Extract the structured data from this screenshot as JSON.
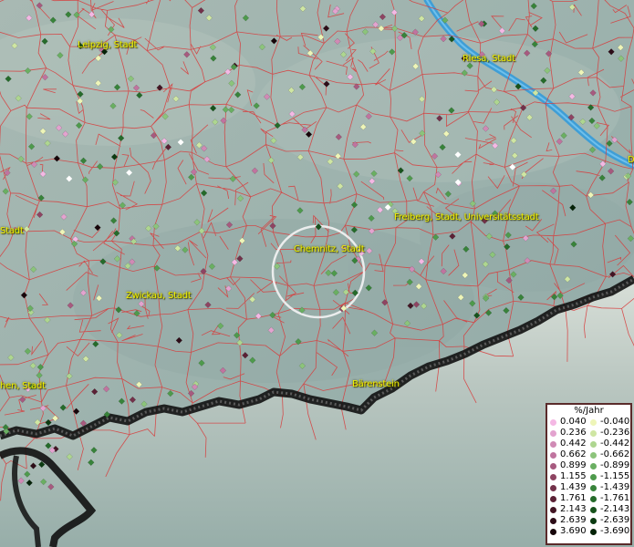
{
  "map": {
    "city_labels": [
      {
        "name": "Leipzig, Stadt"
      },
      {
        "name": "Riesa, Stadt"
      },
      {
        "name": "Freiberg, Stadt, Universitätsstadt"
      },
      {
        "name": "Chemnitz, Stadt"
      },
      {
        "name": "Zwickau, Stadt"
      },
      {
        "name": "Bärenstein"
      },
      {
        "name": "Stadt"
      },
      {
        "name": "hen, Stadt"
      },
      {
        "name": "D"
      }
    ]
  },
  "legend": {
    "title": "%/Jahr",
    "positive": [
      {
        "value": "0.040",
        "color": "#f4b8e4"
      },
      {
        "value": "0.236",
        "color": "#e3a3cf"
      },
      {
        "value": "0.442",
        "color": "#d08ab5"
      },
      {
        "value": "0.662",
        "color": "#c0749f"
      },
      {
        "value": "0.899",
        "color": "#a75a7f"
      },
      {
        "value": "1.155",
        "color": "#8e4462"
      },
      {
        "value": "1.439",
        "color": "#73314a"
      },
      {
        "value": "1.761",
        "color": "#5b2135"
      },
      {
        "value": "2.143",
        "color": "#431524"
      },
      {
        "value": "2.639",
        "color": "#2d0c17"
      },
      {
        "value": "3.690",
        "color": "#17050a"
      }
    ],
    "negative": [
      {
        "value": "-0.040",
        "color": "#eef5b8"
      },
      {
        "value": "-0.236",
        "color": "#cfe6a3"
      },
      {
        "value": "-0.442",
        "color": "#aed690"
      },
      {
        "value": "-0.662",
        "color": "#8cc47b"
      },
      {
        "value": "-0.899",
        "color": "#6aaf62"
      },
      {
        "value": "-1.155",
        "color": "#4e9a4c"
      },
      {
        "value": "-1.439",
        "color": "#38833a"
      },
      {
        "value": "-1.761",
        "color": "#256b2a"
      },
      {
        "value": "-2.143",
        "color": "#17531c"
      },
      {
        "value": "-2.639",
        "color": "#0c3b11"
      },
      {
        "value": "-3.690",
        "color": "#052308"
      }
    ]
  }
}
